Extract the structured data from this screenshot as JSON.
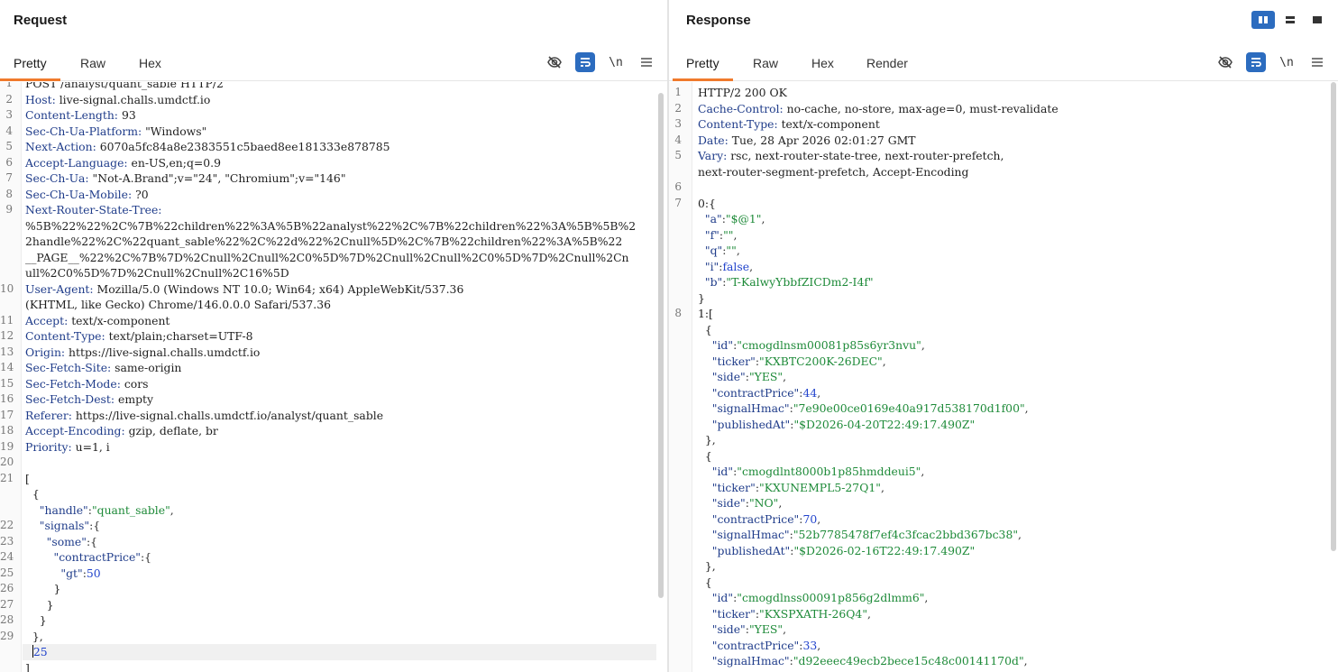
{
  "request": {
    "title": "Request",
    "tabs": [
      "Pretty",
      "Raw",
      "Hex"
    ],
    "active_tab": "Pretty",
    "tools": {
      "ln": "\\n"
    },
    "lines": [
      {
        "n": "1",
        "t": "POST /analyst/quant_sable HTTP/2"
      },
      {
        "n": "2",
        "k": "Host:",
        "v": " live-signal.challs.umdctf.io"
      },
      {
        "n": "3",
        "k": "Content-Length:",
        "v": " 93"
      },
      {
        "n": "4",
        "k": "Sec-Ch-Ua-Platform:",
        "v": " \"Windows\""
      },
      {
        "n": "5",
        "k": "Next-Action:",
        "v": " 6070a5fc84a8e2383551c5baed8ee181333e878785"
      },
      {
        "n": "6",
        "k": "Accept-Language:",
        "v": " en-US,en;q=0.9"
      },
      {
        "n": "7",
        "k": "Sec-Ch-Ua:",
        "v": " \"Not-A.Brand\";v=\"24\", \"Chromium\";v=\"146\""
      },
      {
        "n": "8",
        "k": "Sec-Ch-Ua-Mobile:",
        "v": " ?0"
      },
      {
        "n": "9",
        "k": "Next-Router-State-Tree:",
        "v": ""
      },
      {
        "n": "",
        "t": "%5B%22%22%2C%7B%22children%22%3A%5B%22analyst%22%2C%7B%22children%22%3A%5B%5B%2"
      },
      {
        "n": "",
        "t": "2handle%22%2C%22quant_sable%22%2C%22d%22%2Cnull%5D%2C%7B%22children%22%3A%5B%22"
      },
      {
        "n": "",
        "t": "__PAGE__%22%2C%7B%7D%2Cnull%2Cnull%2C0%5D%7D%2Cnull%2Cnull%2C0%5D%7D%2Cnull%2Cn"
      },
      {
        "n": "",
        "t": "ull%2C0%5D%7D%2Cnull%2Cnull%2C16%5D"
      },
      {
        "n": "10",
        "k": "User-Agent:",
        "v": " Mozilla/5.0 (Windows NT 10.0; Win64; x64) AppleWebKit/537.36"
      },
      {
        "n": "",
        "t": "(KHTML, like Gecko) Chrome/146.0.0.0 Safari/537.36"
      },
      {
        "n": "11",
        "k": "Accept:",
        "v": " text/x-component"
      },
      {
        "n": "12",
        "k": "Content-Type:",
        "v": " text/plain;charset=UTF-8"
      },
      {
        "n": "13",
        "k": "Origin:",
        "v": " https://live-signal.challs.umdctf.io"
      },
      {
        "n": "14",
        "k": "Sec-Fetch-Site:",
        "v": " same-origin"
      },
      {
        "n": "15",
        "k": "Sec-Fetch-Mode:",
        "v": " cors"
      },
      {
        "n": "16",
        "k": "Sec-Fetch-Dest:",
        "v": " empty"
      },
      {
        "n": "17",
        "k": "Referer:",
        "v": " https://live-signal.challs.umdctf.io/analyst/quant_sable"
      },
      {
        "n": "18",
        "k": "Accept-Encoding:",
        "v": " gzip, deflate, br"
      },
      {
        "n": "19",
        "k": "Priority:",
        "v": " u=1, i"
      },
      {
        "n": "20",
        "t": ""
      },
      {
        "n": "21",
        "t": "["
      },
      {
        "n": "",
        "t": "  {"
      },
      {
        "n": "",
        "j": [
          "    ",
          "\"handle\"",
          ":",
          "\"quant_sable\"",
          ","
        ]
      },
      {
        "n": "22",
        "j": [
          "    ",
          "\"signals\"",
          ":{",
          "",
          ""
        ]
      },
      {
        "n": "23",
        "j": [
          "      ",
          "\"some\"",
          ":{",
          "",
          ""
        ]
      },
      {
        "n": "24",
        "j": [
          "        ",
          "\"contractPrice\"",
          ":{",
          "",
          ""
        ]
      },
      {
        "n": "25",
        "jn": [
          "          ",
          "\"gt\"",
          ":",
          "50"
        ]
      },
      {
        "n": "26",
        "t": "        }"
      },
      {
        "n": "27",
        "t": "      }"
      },
      {
        "n": "28",
        "t": "    }"
      },
      {
        "n": "29",
        "t": "  },"
      },
      {
        "n": "",
        "caret": "25"
      },
      {
        "n": "",
        "t": "]"
      }
    ]
  },
  "response": {
    "title": "Response",
    "tabs": [
      "Pretty",
      "Raw",
      "Hex",
      "Render"
    ],
    "active_tab": "Pretty",
    "tools": {
      "ln": "\\n"
    },
    "lines": [
      {
        "n": "1",
        "t": "HTTP/2 200 OK"
      },
      {
        "n": "2",
        "k": "Cache-Control:",
        "v": " no-cache, no-store, max-age=0, must-revalidate"
      },
      {
        "n": "3",
        "k": "Content-Type:",
        "v": " text/x-component"
      },
      {
        "n": "4",
        "k": "Date:",
        "v": " Tue, 28 Apr 2026 02:01:27 GMT"
      },
      {
        "n": "5",
        "k": "Vary:",
        "v": " rsc, next-router-state-tree, next-router-prefetch,"
      },
      {
        "n": "",
        "t": "next-router-segment-prefetch, Accept-Encoding"
      },
      {
        "n": "6",
        "t": ""
      },
      {
        "n": "7",
        "t": "0:{"
      },
      {
        "n": "",
        "j": [
          "  ",
          "\"a\"",
          ":",
          "\"$@1\"",
          ","
        ]
      },
      {
        "n": "",
        "j": [
          "  ",
          "\"f\"",
          ":",
          "\"\"",
          ","
        ]
      },
      {
        "n": "",
        "j": [
          "  ",
          "\"q\"",
          ":",
          "\"\"",
          ","
        ]
      },
      {
        "n": "",
        "jb": [
          "  ",
          "\"i\"",
          ":",
          "false",
          ","
        ]
      },
      {
        "n": "",
        "j": [
          "  ",
          "\"b\"",
          ":",
          "\"T-KalwyYbbfZICDm2-I4f\"",
          ""
        ]
      },
      {
        "n": "",
        "t": "}"
      },
      {
        "n": "8",
        "t": "1:["
      },
      {
        "n": "",
        "t": "  {"
      },
      {
        "n": "",
        "j": [
          "    ",
          "\"id\"",
          ":",
          "\"cmogdlnsm00081p85s6yr3nvu\"",
          ","
        ]
      },
      {
        "n": "",
        "j": [
          "    ",
          "\"ticker\"",
          ":",
          "\"KXBTC200K-26DEC\"",
          ","
        ]
      },
      {
        "n": "",
        "j": [
          "    ",
          "\"side\"",
          ":",
          "\"YES\"",
          ","
        ]
      },
      {
        "n": "",
        "jn": [
          "    ",
          "\"contractPrice\"",
          ":",
          "44",
          ","
        ]
      },
      {
        "n": "",
        "j": [
          "    ",
          "\"signalHmac\"",
          ":",
          "\"7e90e00ce0169e40a917d538170d1f00\"",
          ","
        ]
      },
      {
        "n": "",
        "j": [
          "    ",
          "\"publishedAt\"",
          ":",
          "\"$D2026-04-20T22:49:17.490Z\"",
          ""
        ]
      },
      {
        "n": "",
        "t": "  },"
      },
      {
        "n": "",
        "t": "  {"
      },
      {
        "n": "",
        "j": [
          "    ",
          "\"id\"",
          ":",
          "\"cmogdlnt8000b1p85hmddeui5\"",
          ","
        ]
      },
      {
        "n": "",
        "j": [
          "    ",
          "\"ticker\"",
          ":",
          "\"KXUNEMPL5-27Q1\"",
          ","
        ]
      },
      {
        "n": "",
        "j": [
          "    ",
          "\"side\"",
          ":",
          "\"NO\"",
          ","
        ]
      },
      {
        "n": "",
        "jn": [
          "    ",
          "\"contractPrice\"",
          ":",
          "70",
          ","
        ]
      },
      {
        "n": "",
        "j": [
          "    ",
          "\"signalHmac\"",
          ":",
          "\"52b7785478f7ef4c3fcac2bbd367bc38\"",
          ","
        ]
      },
      {
        "n": "",
        "j": [
          "    ",
          "\"publishedAt\"",
          ":",
          "\"$D2026-02-16T22:49:17.490Z\"",
          ""
        ]
      },
      {
        "n": "",
        "t": "  },"
      },
      {
        "n": "",
        "t": "  {"
      },
      {
        "n": "",
        "j": [
          "    ",
          "\"id\"",
          ":",
          "\"cmogdlnss00091p856g2dlmm6\"",
          ","
        ]
      },
      {
        "n": "",
        "j": [
          "    ",
          "\"ticker\"",
          ":",
          "\"KXSPXATH-26Q4\"",
          ","
        ]
      },
      {
        "n": "",
        "j": [
          "    ",
          "\"side\"",
          ":",
          "\"YES\"",
          ","
        ]
      },
      {
        "n": "",
        "jn": [
          "    ",
          "\"contractPrice\"",
          ":",
          "33",
          ","
        ]
      },
      {
        "n": "",
        "j": [
          "    ",
          "\"signalHmac\"",
          ":",
          "\"d92eeec49ecb2bece15c48c00141170d\"",
          ","
        ]
      }
    ]
  },
  "colors": {
    "accent": "#2c6cbf",
    "tab_underline": "#f07a2c",
    "string": "#1d8a38",
    "number": "#2244cc",
    "key": "#1f3c8a"
  }
}
